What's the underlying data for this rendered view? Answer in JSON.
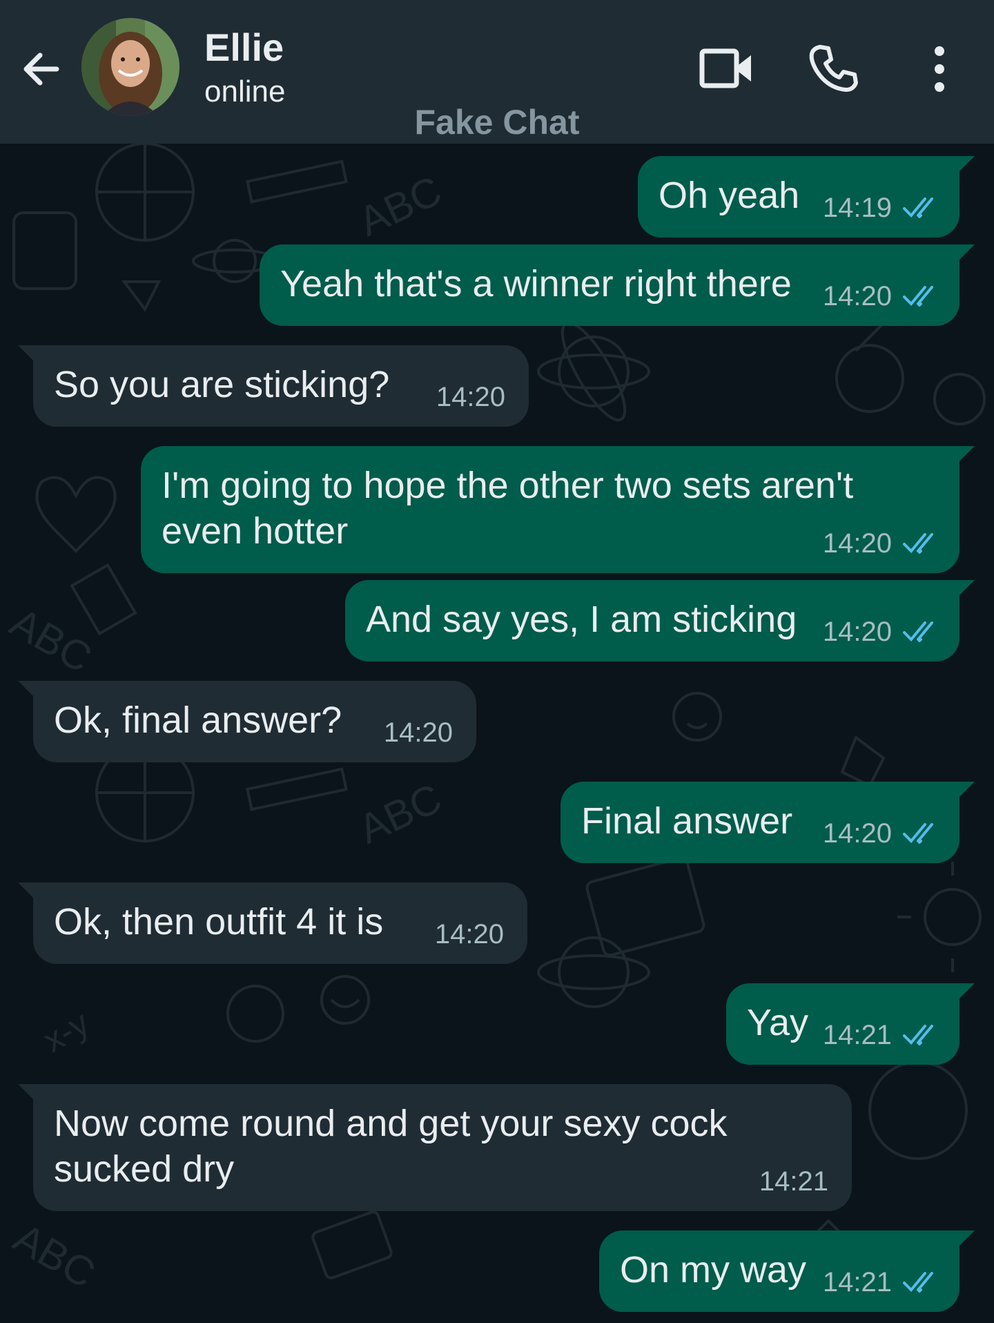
{
  "header": {
    "contact_name": "Ellie",
    "status": "online",
    "watermark": "Fake Chat"
  },
  "colors": {
    "header_bg": "#1f2c34",
    "chat_bg": "#0b141a",
    "outgoing_bubble": "#005c4b",
    "incoming_bubble": "#1f2c34",
    "read_ticks": "#53bdeb"
  },
  "icons": {
    "back": "arrow-left-icon",
    "video": "video-call-icon",
    "call": "phone-icon",
    "menu": "more-vertical-icon",
    "read": "double-check-icon"
  },
  "messages": [
    {
      "direction": "out",
      "text": "Oh yeah",
      "time": "14:19",
      "read": true
    },
    {
      "direction": "out",
      "text": "Yeah that's a winner right there",
      "time": "14:20",
      "read": true
    },
    {
      "direction": "in",
      "text": "So you are sticking?",
      "time": "14:20"
    },
    {
      "direction": "out",
      "text_lines": [
        "I'm going to hope the other two sets aren't",
        "even hotter"
      ],
      "time": "14:20",
      "read": true
    },
    {
      "direction": "out",
      "text": "And say yes, I am sticking",
      "time": "14:20",
      "read": true
    },
    {
      "direction": "in",
      "text": "Ok, final answer?",
      "time": "14:20"
    },
    {
      "direction": "out",
      "text": "Final answer",
      "time": "14:20",
      "read": true
    },
    {
      "direction": "in",
      "text": "Ok, then outfit 4 it is",
      "time": "14:20"
    },
    {
      "direction": "out",
      "text": "Yay",
      "time": "14:21",
      "read": true
    },
    {
      "direction": "in",
      "text_lines": [
        "Now come round and get your sexy cock",
        "sucked dry"
      ],
      "time": "14:21"
    },
    {
      "direction": "out",
      "text": "On my way",
      "time": "14:21",
      "read": true
    }
  ]
}
